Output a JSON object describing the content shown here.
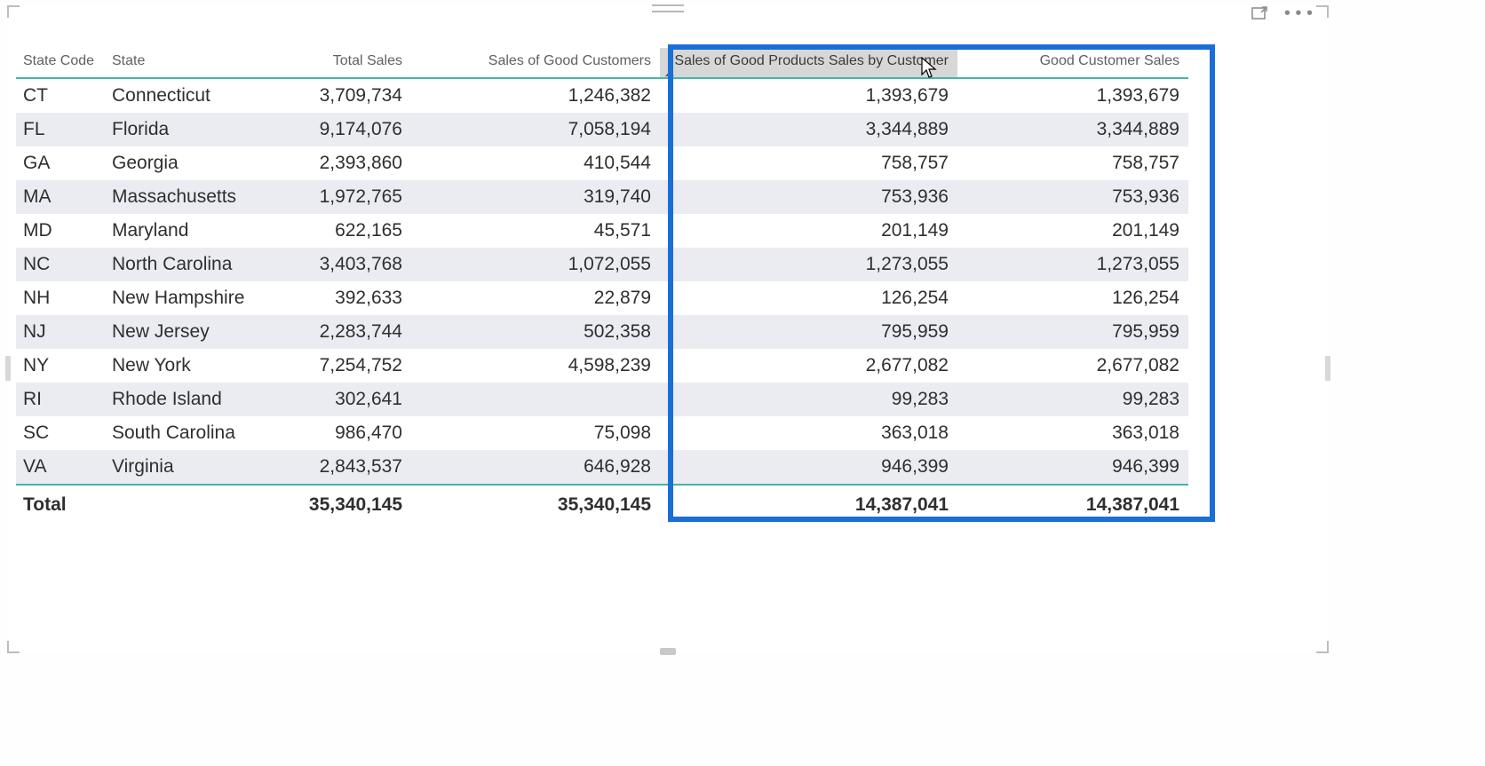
{
  "chart_data": {
    "type": "table",
    "columns": [
      {
        "key": "code",
        "label": "State Code",
        "align": "left"
      },
      {
        "key": "state",
        "label": "State",
        "align": "left"
      },
      {
        "key": "total_sales",
        "label": "Total Sales",
        "align": "right"
      },
      {
        "key": "good_cust",
        "label": "Sales of Good Customers",
        "align": "right"
      },
      {
        "key": "good_prod",
        "label": "Sales of Good Products Sales by Customer",
        "align": "right",
        "sorted": "asc",
        "highlighted": true
      },
      {
        "key": "cust_sales",
        "label": "Good Customer Sales",
        "align": "right",
        "highlighted": true
      }
    ],
    "rows": [
      {
        "code": "CT",
        "state": "Connecticut",
        "total_sales": "3,709,734",
        "good_cust": "1,246,382",
        "good_prod": "1,393,679",
        "cust_sales": "1,393,679"
      },
      {
        "code": "FL",
        "state": "Florida",
        "total_sales": "9,174,076",
        "good_cust": "7,058,194",
        "good_prod": "3,344,889",
        "cust_sales": "3,344,889"
      },
      {
        "code": "GA",
        "state": "Georgia",
        "total_sales": "2,393,860",
        "good_cust": "410,544",
        "good_prod": "758,757",
        "cust_sales": "758,757"
      },
      {
        "code": "MA",
        "state": "Massachusetts",
        "total_sales": "1,972,765",
        "good_cust": "319,740",
        "good_prod": "753,936",
        "cust_sales": "753,936"
      },
      {
        "code": "MD",
        "state": "Maryland",
        "total_sales": "622,165",
        "good_cust": "45,571",
        "good_prod": "201,149",
        "cust_sales": "201,149"
      },
      {
        "code": "NC",
        "state": "North Carolina",
        "total_sales": "3,403,768",
        "good_cust": "1,072,055",
        "good_prod": "1,273,055",
        "cust_sales": "1,273,055"
      },
      {
        "code": "NH",
        "state": "New Hampshire",
        "total_sales": "392,633",
        "good_cust": "22,879",
        "good_prod": "126,254",
        "cust_sales": "126,254"
      },
      {
        "code": "NJ",
        "state": "New Jersey",
        "total_sales": "2,283,744",
        "good_cust": "502,358",
        "good_prod": "795,959",
        "cust_sales": "795,959"
      },
      {
        "code": "NY",
        "state": "New York",
        "total_sales": "7,254,752",
        "good_cust": "4,598,239",
        "good_prod": "2,677,082",
        "cust_sales": "2,677,082"
      },
      {
        "code": "RI",
        "state": "Rhode Island",
        "total_sales": "302,641",
        "good_cust": "",
        "good_prod": "99,283",
        "cust_sales": "99,283"
      },
      {
        "code": "SC",
        "state": "South Carolina",
        "total_sales": "986,470",
        "good_cust": "75,098",
        "good_prod": "363,018",
        "cust_sales": "363,018"
      },
      {
        "code": "VA",
        "state": "Virginia",
        "total_sales": "2,843,537",
        "good_cust": "646,928",
        "good_prod": "946,399",
        "cust_sales": "946,399"
      }
    ],
    "totals": {
      "label": "Total",
      "total_sales": "35,340,145",
      "good_cust": "35,340,145",
      "good_prod": "14,387,041",
      "cust_sales": "14,387,041"
    }
  },
  "header_buttons": {
    "focus_mode": "Focus mode",
    "more": "More options"
  }
}
